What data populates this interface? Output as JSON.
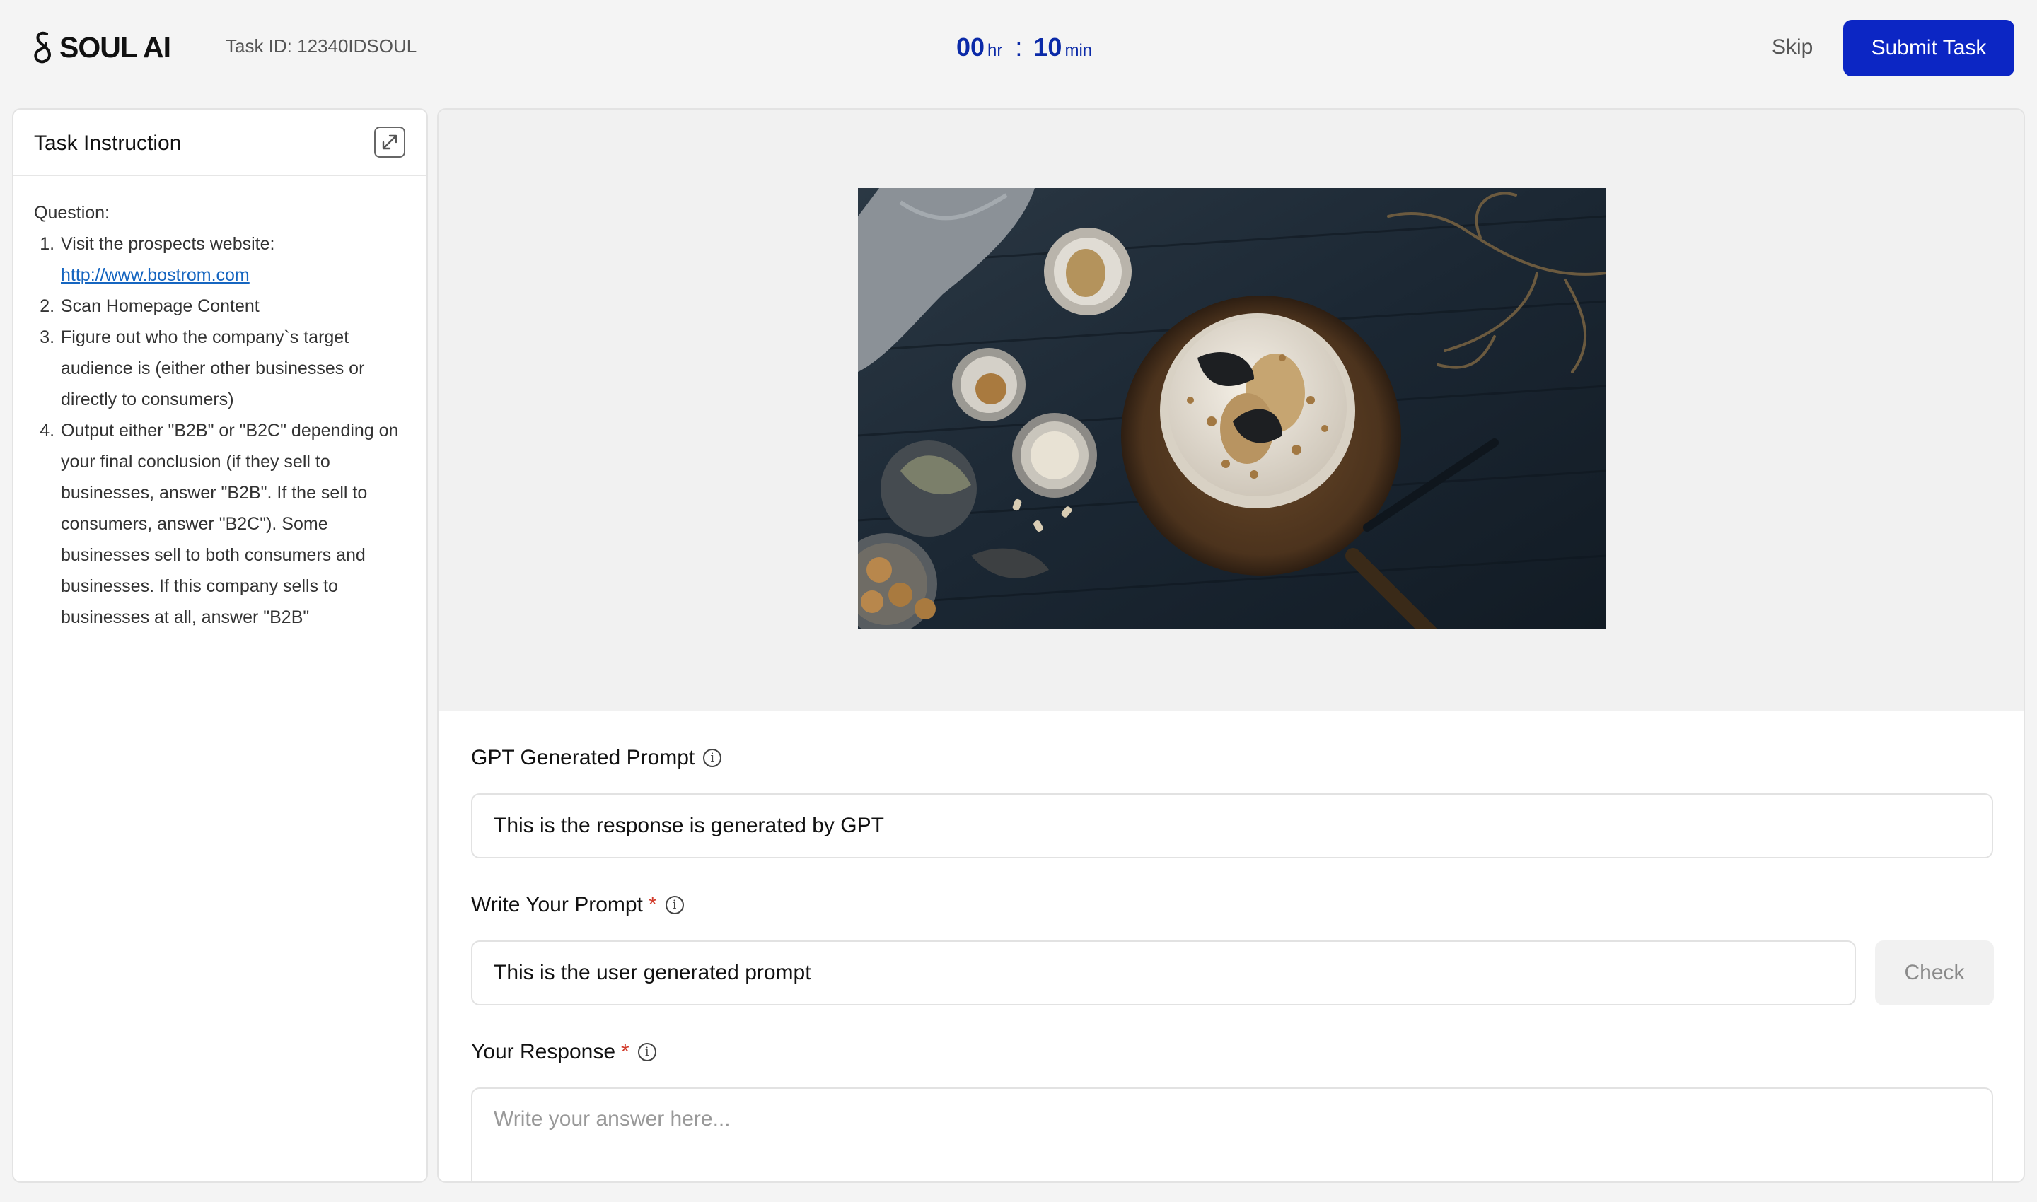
{
  "header": {
    "logo_text": "SOUL AI",
    "task_id": "Task ID: 12340IDSOUL",
    "timer": {
      "hours": "00",
      "hours_unit": "hr",
      "separator": ":",
      "minutes": "10",
      "minutes_unit": "min"
    },
    "skip_label": "Skip",
    "submit_label": "Submit Task"
  },
  "instructions": {
    "title": "Task Instruction",
    "question_label": "Question:",
    "step1_text": "Visit the prospects website: ",
    "step1_link": "http://www.bostrom.com",
    "step2": "Scan Homepage Content",
    "step3": "Figure out who the company`s target audience is (either other businesses or directly to consumers)",
    "step4": "Output either \"B2B\" or \"B2C\" depending on your final conclusion (if they sell to businesses, answer \"B2B\". If the sell to consumers, answer \"B2C\"). Some businesses sell to both consumers and businesses. If this company sells to businesses at all, answer \"B2B\""
  },
  "form": {
    "gpt_prompt_label": "GPT Generated Prompt",
    "gpt_prompt_value": "This is the response is generated by GPT",
    "user_prompt_label": "Write Your Prompt",
    "required_mark": "*",
    "user_prompt_value": "This is the user generated prompt",
    "check_label": "Check",
    "response_label": "Your Response",
    "response_placeholder": "Write your answer here..."
  },
  "colors": {
    "accent": "#0c26c4",
    "timer": "#0b2aa8",
    "required": "#d23b2b",
    "link": "#1565c0"
  }
}
